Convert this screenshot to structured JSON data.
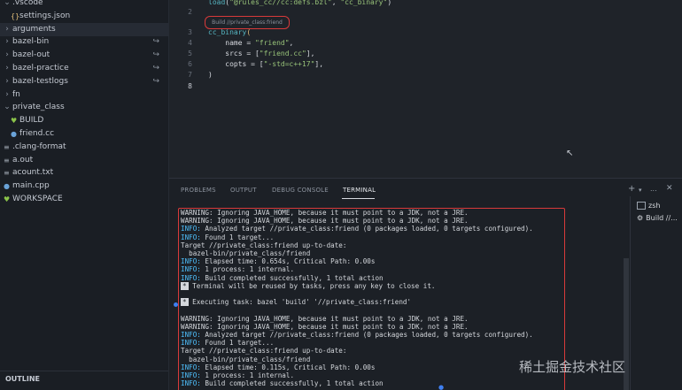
{
  "explorer": {
    "items": [
      {
        "label": ".vscode",
        "kind": "folder",
        "open": true,
        "depth": 0
      },
      {
        "label": "settings.json",
        "kind": "json",
        "depth": 1
      },
      {
        "label": "arguments",
        "kind": "folder",
        "open": false,
        "depth": 0,
        "selected": true
      },
      {
        "label": "bazel-bin",
        "kind": "folder",
        "open": false,
        "depth": 0,
        "link": true
      },
      {
        "label": "bazel-out",
        "kind": "folder",
        "open": false,
        "depth": 0,
        "link": true
      },
      {
        "label": "bazel-practice",
        "kind": "folder",
        "open": false,
        "depth": 0,
        "link": true
      },
      {
        "label": "bazel-testlogs",
        "kind": "folder",
        "open": false,
        "depth": 0,
        "link": true
      },
      {
        "label": "fn",
        "kind": "folder",
        "open": false,
        "depth": 0
      },
      {
        "label": "private_class",
        "kind": "folder",
        "open": true,
        "depth": 0
      },
      {
        "label": "BUILD",
        "kind": "bazel",
        "depth": 1
      },
      {
        "label": "friend.cc",
        "kind": "cpp",
        "depth": 1
      },
      {
        "label": ".clang-format",
        "kind": "text",
        "depth": 0
      },
      {
        "label": "a.out",
        "kind": "text",
        "depth": 0
      },
      {
        "label": "acount.txt",
        "kind": "text",
        "depth": 0
      },
      {
        "label": "main.cpp",
        "kind": "cpp",
        "depth": 0
      },
      {
        "label": "WORKSPACE",
        "kind": "bazel",
        "depth": 0
      }
    ],
    "outline_label": "OUTLINE"
  },
  "editor": {
    "codelens": "Build //private_class:friend",
    "lines": [
      {
        "n": "3",
        "text": "cc_binary("
      },
      {
        "n": "4",
        "text": "    name = \"friend\","
      },
      {
        "n": "5",
        "text": "    srcs = [\"friend.cc\"],"
      },
      {
        "n": "6",
        "text": "    copts = [\"-std=c++17\"],"
      },
      {
        "n": "7",
        "text": ")"
      },
      {
        "n": "8",
        "text": ""
      }
    ],
    "top_line": "load(\"@rules_cc//cc:defs.bzl\", \"cc_binary\")",
    "line2_number": "2"
  },
  "panel": {
    "tabs": [
      "PROBLEMS",
      "OUTPUT",
      "DEBUG CONSOLE",
      "TERMINAL"
    ],
    "active_tab": "TERMINAL",
    "add_icon": "+",
    "more_icon": "...",
    "terminal_sessions": [
      "zsh",
      "Build //..."
    ],
    "terminal_lines": [
      {
        "type": "plain",
        "text": "WARNING: Ignoring JAVA_HOME, because it must point to a JDK, not a JRE."
      },
      {
        "type": "plain",
        "text": "WARNING: Ignoring JAVA_HOME, because it must point to a JDK, not a JRE."
      },
      {
        "type": "info",
        "prefix": "INFO:",
        "text": " Analyzed target //private_class:friend (0 packages loaded, 0 targets configured)."
      },
      {
        "type": "info",
        "prefix": "INFO:",
        "text": " Found 1 target..."
      },
      {
        "type": "plain",
        "text": "Target //private_class:friend up-to-date:"
      },
      {
        "type": "plain",
        "text": "  bazel-bin/private_class/friend"
      },
      {
        "type": "info",
        "prefix": "INFO:",
        "text": " Elapsed time: 0.654s, Critical Path: 0.00s"
      },
      {
        "type": "info",
        "prefix": "INFO:",
        "text": " 1 process: 1 internal."
      },
      {
        "type": "info",
        "prefix": "INFO:",
        "text": " Build completed successfully, 1 total action"
      },
      {
        "type": "task",
        "prefix": "*",
        "text": " Terminal will be reused by tasks, press any key to close it."
      },
      {
        "type": "blank",
        "text": ""
      },
      {
        "type": "task",
        "prefix": "*",
        "text": " Executing task: bazel 'build' '//private_class:friend'"
      },
      {
        "type": "blank",
        "text": ""
      },
      {
        "type": "plain",
        "text": "WARNING: Ignoring JAVA_HOME, because it must point to a JDK, not a JRE."
      },
      {
        "type": "plain",
        "text": "WARNING: Ignoring JAVA_HOME, because it must point to a JDK, not a JRE."
      },
      {
        "type": "info",
        "prefix": "INFO:",
        "text": " Analyzed target //private_class:friend (0 packages loaded, 0 targets configured)."
      },
      {
        "type": "info",
        "prefix": "INFO:",
        "text": " Found 1 target..."
      },
      {
        "type": "plain",
        "text": "Target //private_class:friend up-to-date:"
      },
      {
        "type": "plain",
        "text": "  bazel-bin/private_class/friend"
      },
      {
        "type": "info",
        "prefix": "INFO:",
        "text": " Elapsed time: 0.115s, Critical Path: 0.00s"
      },
      {
        "type": "info",
        "prefix": "INFO:",
        "text": " 1 process: 1 internal."
      },
      {
        "type": "info",
        "prefix": "INFO:",
        "text": " Build completed successfully, 1 total action"
      }
    ]
  },
  "watermark": "稀土掘金技术社区",
  "colors": {
    "info": "#4fc1ff",
    "highlight_box": "#d83a3a",
    "string": "#98c379",
    "keyword": "#56b6c2"
  }
}
